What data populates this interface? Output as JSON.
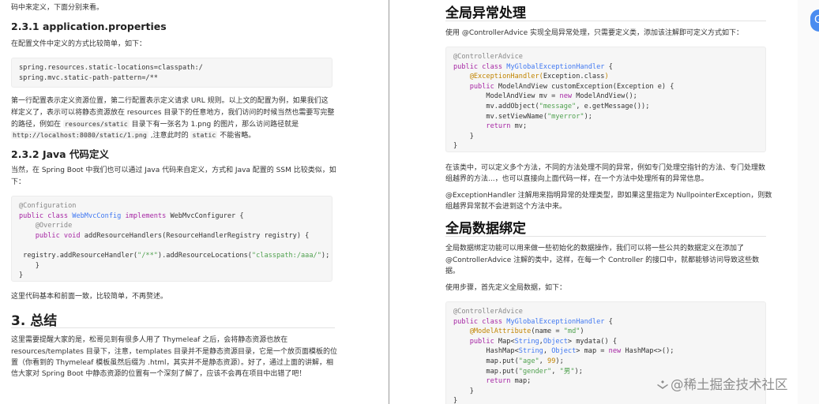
{
  "left": {
    "top_line": "码中来定义，下面分别来看。",
    "s231": {
      "heading": "2.3.1 application.properties",
      "intro": "在配置文件中定义的方式比较简单，如下：",
      "code": [
        "spring.resources.static-locations=classpath:/",
        "spring.mvc.static-path-pattern=/**"
      ],
      "para": [
        "第一行配置表示定义资源位置，第二行配置表示定义请求 URL 规则。以上文的配置为例，如果我们这",
        "样定义了，表示可以将静态资源放在 resources 目录下的任意地方，我们访问的时候当然也需要写完整",
        {
          "a": "的路径，例如在 ",
          "c1": "resources/static",
          "b": " 目录下有一张名为 1.png 的图片，那么访问路径就是"
        },
        {
          "c1": "http://localhost:8080/static/1.png",
          "a": " ,注意此时的 ",
          "c2": "static",
          "b": " 不能省略。"
        }
      ]
    },
    "s232": {
      "heading": "2.3.2 Java 代码定义",
      "para": [
        "当然，在 Spring Boot 中我们也可以通过 Java 代码来自定义，方式和 Java 配置的 SSM 比较类似，如",
        "下："
      ],
      "code": {
        "l1": "@Configuration",
        "l2": {
          "kw": "public class ",
          "ty": "WebMvcConfig ",
          "kw2": "implements ",
          "rest": "WebMvcConfigurer {"
        },
        "l3": "    @Override",
        "l4": {
          "kw": "    public void ",
          "rest": "addResourceHandlers(ResourceHandlerRegistry registry) {"
        },
        "l6": {
          "a": " registry.addResourceHandler(",
          "s1": "\"/**\"",
          "b": ").addResourceLocations(",
          "s2": "\"classpath:/aaa/\"",
          "c": ");"
        },
        "l7": "    }",
        "l8": "}"
      },
      "after": "这里代码基本和前面一致，比较简单，不再赘述。"
    },
    "s3": {
      "heading": "3. 总结",
      "para": [
        "这里需要提醒大家的是，松哥见到有很多人用了 Thymeleaf 之后，会将静态资源也放在",
        "resources/templates 目录下，注意，templates 目录并不是静态资源目录，它是一个放页面模板的位",
        "置（你看到的 Thymeleaf 模板虽然后缀为 .html，其实并不是静态资源）。好了，通过上面的讲解，相",
        "信大家对 Spring Boot 中静态资源的位置有一个深刻了解了，应该不会再在项目中出错了吧！"
      ]
    }
  },
  "right": {
    "exc": {
      "heading": "全局异常处理",
      "intro": "使用 @ControllerAdvice 实现全局异常处理，只需要定义类，添加该注解即可定义方式如下：",
      "code": {
        "l1": "@ControllerAdvice",
        "l2": {
          "kw": "public class ",
          "ty": "MyGlobalExceptionHandler",
          "rest": " {"
        },
        "l3": {
          "an": "    @ExceptionHandler(",
          "rest": "Exception.class",
          "an2": ")"
        },
        "l4": {
          "kw": "    public ",
          "rest": "ModelAndView customException(Exception e) {"
        },
        "l5": {
          "a": "        ModelAndView mv = ",
          "kw": "new ",
          "b": "ModelAndView();"
        },
        "l6": {
          "a": "        mv.addObject(",
          "s": "\"message\"",
          "b": ", e.getMessage());"
        },
        "l7": {
          "a": "        mv.setViewName(",
          "s": "\"myerror\"",
          "b": ");"
        },
        "l8": {
          "kw": "        return ",
          "rest": "mv;"
        },
        "l9": "    }",
        "l10": "}"
      },
      "para": [
        "在该类中，可以定义多个方法，不同的方法处理不同的异常，例如专门处理空指针的方法、专门处理数",
        "组越界的方法...，也可以直接向上面代码一样，在一个方法中处理所有的异常信息。"
      ],
      "para2": [
        "@ExceptionHandler 注解用来指明异常的处理类型，即如果这里指定为 NullpointerException，则数",
        "组越界异常就不会进到这个方法中来。"
      ]
    },
    "bind": {
      "heading": "全局数据绑定",
      "para": [
        "全局数据绑定功能可以用来做一些初始化的数据操作，我们可以将一些公共的数据定义在添加了",
        "@ControllerAdvice 注解的类中，这样，在每一个 Controller 的接口中，就都能够访问导致这些数",
        "据。"
      ],
      "step": "使用步骤，首先定义全局数据，如下：",
      "code": {
        "l1": "@ControllerAdvice",
        "l2": {
          "kw": "public class ",
          "ty": "MyGlobalExceptionHandler",
          "rest": " {"
        },
        "l3": {
          "an": "    @ModelAttribute",
          "rest": "(name = ",
          "s": "\"md\"",
          "end": ")"
        },
        "l4": {
          "kw": "    public ",
          "a": "Map<",
          "ty1": "String",
          "b": ",",
          "ty2": "Object",
          "c": "> mydata() {"
        },
        "l5": {
          "a": "        HashMap<",
          "ty1": "String",
          "b": ", ",
          "ty2": "Object",
          "c": "> map = ",
          "kw": "new ",
          "d": "HashMap<>();"
        },
        "l6": {
          "a": "        map.put(",
          "s1": "\"age\"",
          "b": ", ",
          "n": "99",
          "c": ");"
        },
        "l7": {
          "a": "        map.put(",
          "s1": "\"gender\"",
          "b": ", ",
          "s2": "\"男\"",
          "c": ");"
        },
        "l8": {
          "kw": "        return ",
          "rest": "map;"
        },
        "l9": "    }",
        "l10": "}"
      }
    }
  },
  "watermark": "@稀土掘金技术社区",
  "badge": "G"
}
